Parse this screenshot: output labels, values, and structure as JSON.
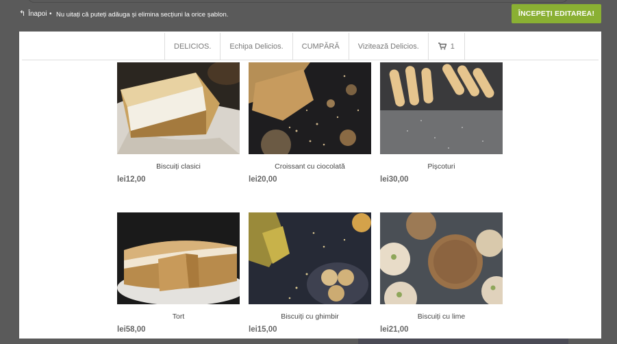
{
  "topbar": {
    "back_label": "Înapoi",
    "separator": "•",
    "notice": "Nu uitați că puteți adăuga și elimina secțiuni la orice șablon.",
    "start_button": "ÎNCEPEȚI EDITAREA!"
  },
  "nav": {
    "items": [
      {
        "label": "DELICIOS."
      },
      {
        "label": "Echipa Delicios."
      },
      {
        "label": "CUMPĂRĂ"
      },
      {
        "label": "Vizitează Delicios."
      }
    ],
    "cart_count": "1"
  },
  "products": [
    {
      "title": "Biscuiți clasici",
      "price": "lei12,00"
    },
    {
      "title": "Croissant cu ciocolată",
      "price": "lei20,00"
    },
    {
      "title": "Pișcoturi",
      "price": "lei30,00"
    },
    {
      "title": "Tort",
      "price": "lei58,00"
    },
    {
      "title": "Biscuiți cu ghimbir",
      "price": "lei15,00"
    },
    {
      "title": "Biscuiți cu lime",
      "price": "lei21,00"
    }
  ],
  "colors": {
    "accent": "#8ab033",
    "frame": "#5a5a5a",
    "price": "#666666"
  }
}
